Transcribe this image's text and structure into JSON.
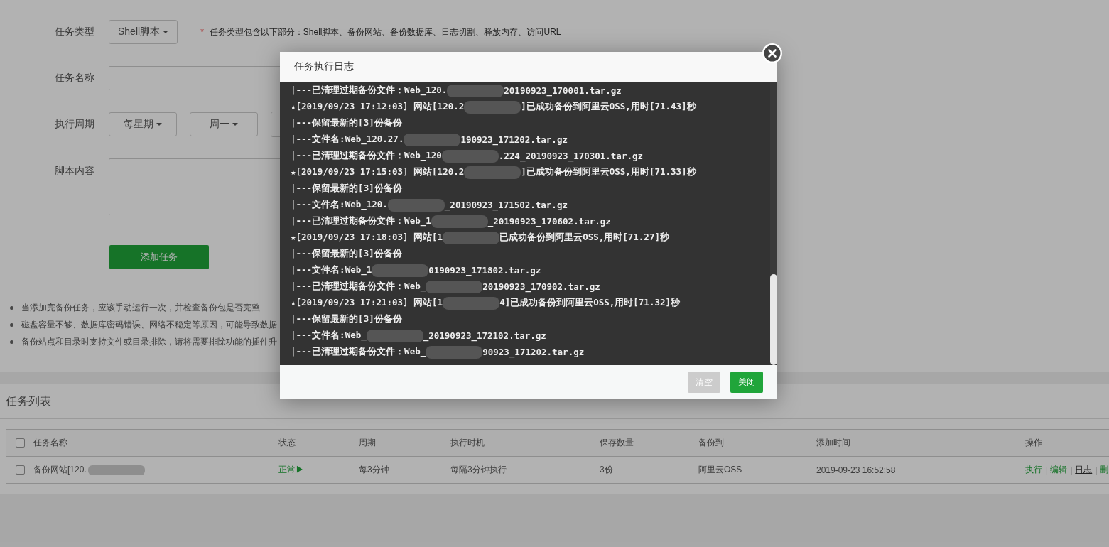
{
  "form": {
    "type_label": "任务类型",
    "type_value": "Shell脚本",
    "type_note_mark": "*",
    "type_note": "任务类型包含以下部分：Shell脚本、备份网站、备份数据库、日志切割、释放内存、访问URL",
    "name_label": "任务名称",
    "period_label": "执行周期",
    "period_values": [
      "每星期",
      "周一"
    ],
    "script_label": "脚本内容",
    "submit": "添加任务"
  },
  "notes": [
    "当添加完备份任务，应该手动运行一次，并检查备份包是否完整",
    "磁盘容量不够、数据库密码错误、网络不稳定等原因，可能导致数据",
    "备份站点和目录时支持文件或目录排除，请将需要排除功能的插件升"
  ],
  "task_list": {
    "title": "任务列表",
    "all_checked": false,
    "columns": [
      "任务名称",
      "状态",
      "周期",
      "执行时机",
      "保存数量",
      "备份到",
      "添加时间",
      "操作"
    ],
    "rows": [
      {
        "checked": false,
        "name": "备份网站[120.",
        "status": "正常▶",
        "period": "每3分钟",
        "timing": "每隔3分钟执行",
        "count": "3份",
        "target": "阿里云OSS",
        "added": "2019-09-23 16:52:58",
        "actions": [
          {
            "kind": "link",
            "text": "执行",
            "hovered": false
          },
          {
            "kind": "sep",
            "text": "|"
          },
          {
            "kind": "link",
            "text": "编辑",
            "hovered": false
          },
          {
            "kind": "sep",
            "text": "|"
          },
          {
            "kind": "link",
            "text": "日志",
            "hovered": true
          },
          {
            "kind": "sep",
            "text": "|"
          },
          {
            "kind": "link",
            "text": "删",
            "hovered": false
          }
        ]
      }
    ]
  },
  "dialog": {
    "title": "任务执行日志",
    "lines": [
      {
        "segments": [
          "|---已清理过期备份文件：Web_120.",
          "20190923_170001.tar.gz"
        ]
      },
      {
        "segments": [
          "★[2019/09/23 17:12:03] 网站[120.2",
          "]已成功备份到阿里云OSS,用时[71.43]秒"
        ]
      },
      {
        "segments": [
          "|---保留最新的[3]份备份"
        ]
      },
      {
        "segments": [
          "|---文件名:Web_120.27.",
          "190923_171202.tar.gz"
        ]
      },
      {
        "segments": [
          "|---已清理过期备份文件：Web_120",
          ".224_20190923_170301.tar.gz"
        ]
      },
      {
        "segments": [
          "★[2019/09/23 17:15:03] 网站[120.2",
          "]已成功备份到阿里云OSS,用时[71.33]秒"
        ]
      },
      {
        "segments": [
          "|---保留最新的[3]份备份"
        ]
      },
      {
        "segments": [
          "|---文件名:Web_120.",
          "_20190923_171502.tar.gz"
        ]
      },
      {
        "segments": [
          "|---已清理过期备份文件：Web_1",
          "_20190923_170602.tar.gz"
        ]
      },
      {
        "segments": [
          "★[2019/09/23 17:18:03] 网站[1",
          "已成功备份到阿里云OSS,用时[71.27]秒"
        ]
      },
      {
        "segments": [
          "|---保留最新的[3]份备份"
        ]
      },
      {
        "segments": [
          "|---文件名:Web_1",
          "0190923_171802.tar.gz"
        ]
      },
      {
        "segments": [
          "|---已清理过期备份文件：Web_",
          "20190923_170902.tar.gz"
        ]
      },
      {
        "segments": [
          "★[2019/09/23 17:21:03] 网站[1",
          "4]已成功备份到阿里云OSS,用时[71.32]秒"
        ]
      },
      {
        "segments": [
          "|---保留最新的[3]份备份"
        ]
      },
      {
        "segments": [
          "|---文件名:Web_",
          "_20190923_172102.tar.gz"
        ]
      },
      {
        "segments": [
          "|---已清理过期备份文件：Web_",
          "90923_171202.tar.gz"
        ]
      }
    ],
    "buttons": [
      {
        "label": "清空",
        "disabled": true
      },
      {
        "label": "关闭",
        "disabled": false
      }
    ]
  }
}
